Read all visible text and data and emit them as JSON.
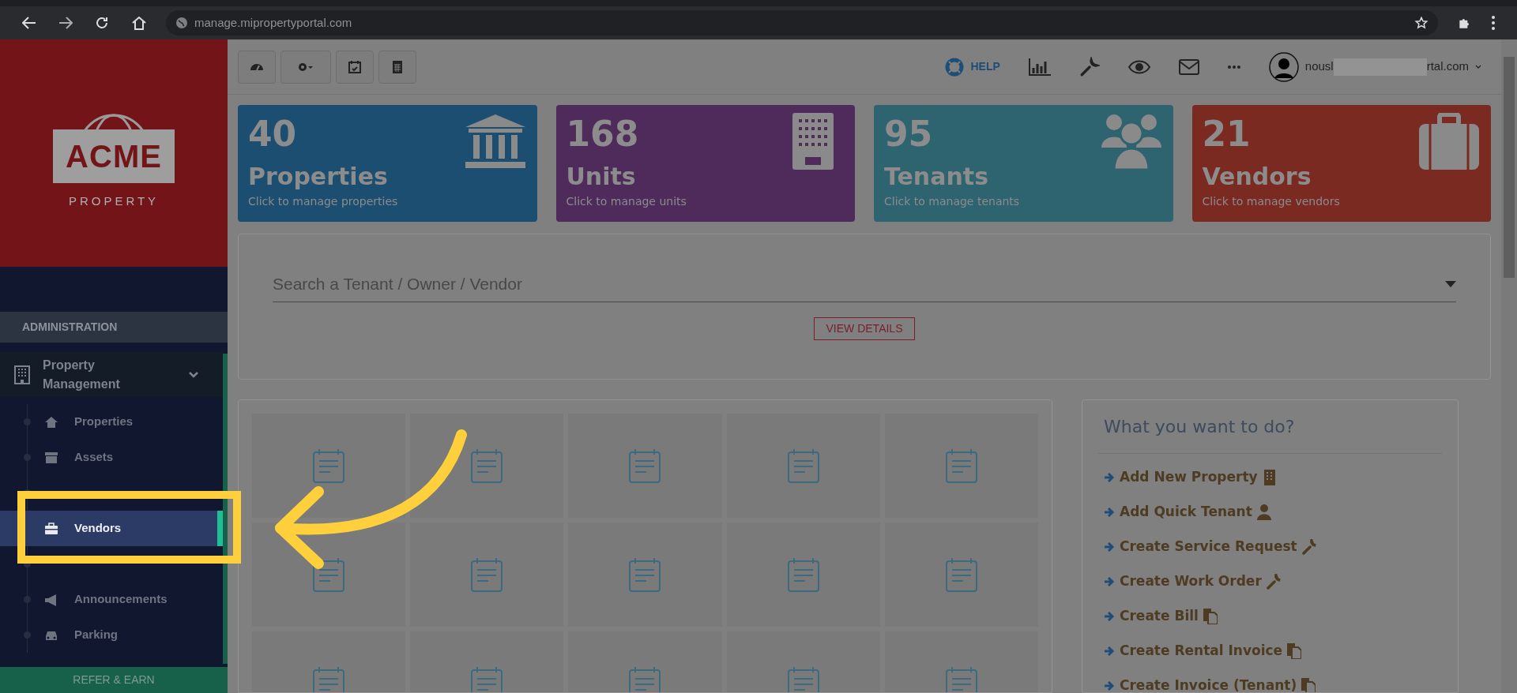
{
  "browser": {
    "url": "manage.mipropertyportal.com"
  },
  "sidebar": {
    "logo": {
      "name": "ACME",
      "tagline": "PROPERTY"
    },
    "section": "ADMINISTRATION",
    "group": {
      "label": "Property Management",
      "expanded": true,
      "items": [
        {
          "label": "Properties",
          "selected": false
        },
        {
          "label": "Assets",
          "selected": false
        },
        {
          "covered": true
        },
        {
          "label": "Vendors",
          "selected": true
        },
        {
          "covered": true
        },
        {
          "label": "Announcements",
          "selected": false
        },
        {
          "label": "Parking",
          "selected": false
        }
      ]
    },
    "refer": "REFER & EARN"
  },
  "header": {
    "help": "HELP",
    "user_start": "nousl",
    "user_end": "rtal.com"
  },
  "stats": [
    {
      "count": "40",
      "label": "Properties",
      "subtitle": "Click to manage properties",
      "color": "#1c4e72"
    },
    {
      "count": "168",
      "label": "Units",
      "subtitle": "Click to manage units",
      "color": "#4e2b5b"
    },
    {
      "count": "95",
      "label": "Tenants",
      "subtitle": "Click to manage tenants",
      "color": "#2e6370"
    },
    {
      "count": "21",
      "label": "Vendors",
      "subtitle": "Click to manage vendors",
      "color": "#7a2a21"
    }
  ],
  "search": {
    "placeholder": "Search a Tenant / Owner / Vendor",
    "button": "VIEW DETAILS"
  },
  "actions": {
    "title": "What you want to do?",
    "items": [
      {
        "label": "Add New Property"
      },
      {
        "label": "Add Quick Tenant"
      },
      {
        "label": "Create Service Request"
      },
      {
        "label": "Create Work Order"
      },
      {
        "label": "Create Bill"
      },
      {
        "label": "Create Rental Invoice"
      },
      {
        "label": "Create Invoice (Tenant)"
      }
    ]
  }
}
